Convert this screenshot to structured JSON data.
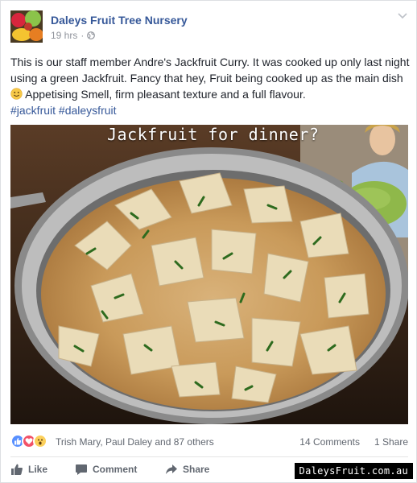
{
  "post": {
    "page_name": "Daleys Fruit Tree Nursery",
    "time_ago": "19 hrs",
    "separator": "·",
    "audience_icon": "globe-icon",
    "text_line1": "This is our staff member Andre's Jackfruit Curry. It was cooked up only last night using a green Jackfruit. Fancy that hey, Fruit being cooked up as the main dish ",
    "text_line2": " Appetising Smell, firm pleasant texture and a full flavour.",
    "hashtags": [
      "#jackfruit",
      "#daleysfruit"
    ],
    "photo_caption": "Jackfruit for dinner?",
    "watermark": "DaleysFruit.com.au"
  },
  "reactions": {
    "icons": [
      "like-reaction-icon",
      "love-reaction-icon",
      "wow-reaction-icon"
    ],
    "reactors": "Trish Mary, Paul Daley and 87 others",
    "comments": "14 Comments",
    "shares": "1 Share"
  },
  "actions": {
    "like_label": "Like",
    "comment_label": "Comment",
    "share_label": "Share"
  },
  "colors": {
    "link_blue": "#365899",
    "meta_gray": "#90949c",
    "like_blue": "#5890ff",
    "love_red": "#f25268",
    "wow_yellow": "#fcd05c"
  }
}
